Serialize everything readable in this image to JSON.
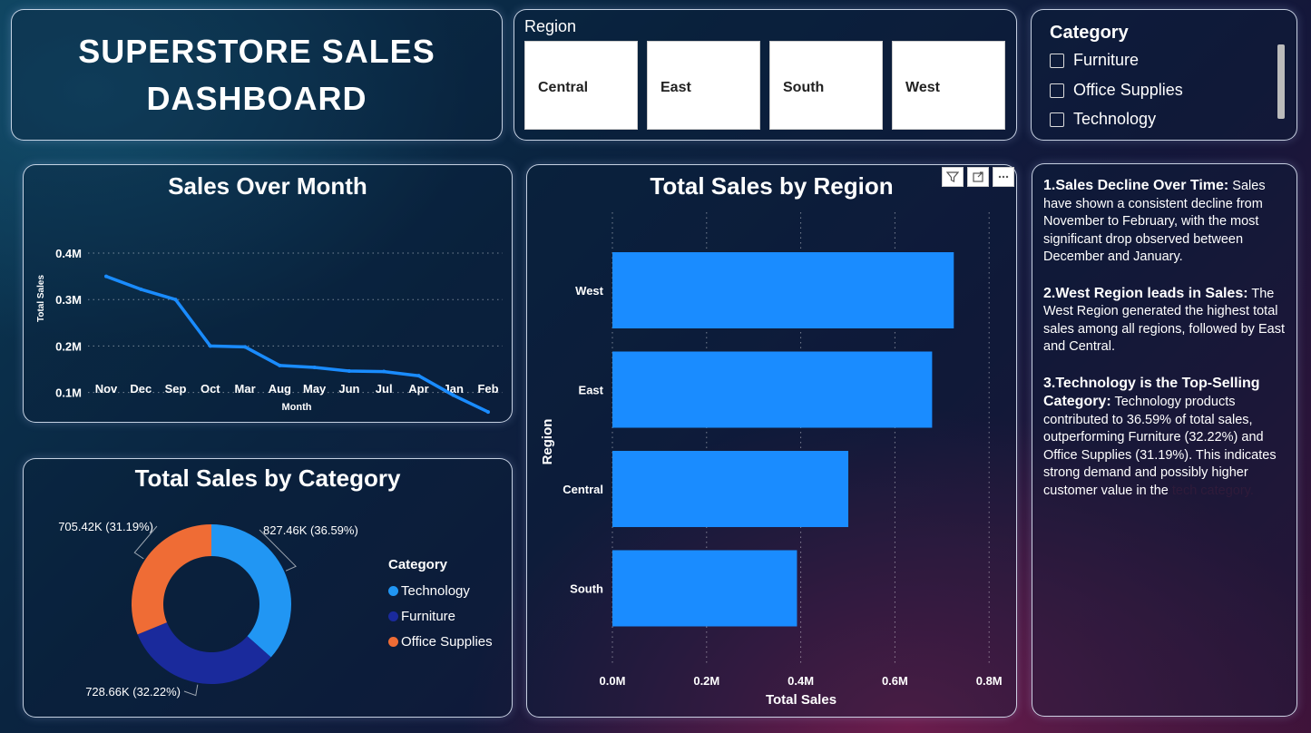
{
  "title": {
    "line1": "SUPERSTORE SALES",
    "line2": "DASHBOARD"
  },
  "region_slicer": {
    "label": "Region",
    "options": [
      "Central",
      "East",
      "South",
      "West"
    ]
  },
  "category_slicer": {
    "label": "Category",
    "options": [
      "Furniture",
      "Office Supplies",
      "Technology"
    ]
  },
  "insights": [
    {
      "heading": "1.Sales Decline Over Time:",
      "body": "Sales have shown a consistent decline from November to February, with the most significant drop observed between December and January."
    },
    {
      "heading": "2.West Region leads in Sales:",
      "body": "The West Region generated the highest total sales among all regions, followed by East and Central."
    },
    {
      "heading": "3.Technology is the Top-Selling Category:",
      "body": "Technology products contributed to 36.59% of total sales, outperforming Furniture (32.22%) and Office Supplies (31.19%). This indicates strong demand and possibly higher customer value in the",
      "faded": "tech category."
    }
  ],
  "visual_header_icons": [
    "filter-icon",
    "focus-mode-icon",
    "more-options-icon"
  ],
  "colors": {
    "bar": "#1a8cff",
    "line": "#1a8cff",
    "technology": "#2196f3",
    "furniture": "#1a2a9c",
    "office_supplies": "#ef6c35"
  },
  "chart_data": [
    {
      "type": "line",
      "title": "Sales Over Month",
      "xlabel": "Month",
      "ylabel": "Total Sales",
      "categories": [
        "Nov",
        "Dec",
        "Sep",
        "Oct",
        "Mar",
        "Aug",
        "May",
        "Jun",
        "Jul",
        "Apr",
        "Jan",
        "Feb"
      ],
      "values": [
        0.35,
        0.322,
        0.3,
        0.2,
        0.198,
        0.158,
        0.154,
        0.146,
        0.145,
        0.136,
        0.094,
        0.058
      ],
      "y_ticks": [
        "0.1M",
        "0.2M",
        "0.3M",
        "0.4M"
      ],
      "y_tick_values": [
        0.1,
        0.2,
        0.3,
        0.4
      ],
      "ylim": [
        0.05,
        0.4
      ],
      "grid": true
    },
    {
      "type": "bar",
      "orientation": "horizontal",
      "title": "Total Sales by Region",
      "xlabel": "Total Sales",
      "ylabel": "Region",
      "categories": [
        "West",
        "East",
        "Central",
        "South"
      ],
      "values": [
        0.725,
        0.679,
        0.501,
        0.392
      ],
      "x_ticks": [
        "0.0M",
        "0.2M",
        "0.4M",
        "0.6M",
        "0.8M"
      ],
      "x_tick_values": [
        0,
        0.2,
        0.4,
        0.6,
        0.8
      ],
      "xlim": [
        0,
        0.8
      ],
      "grid": true
    },
    {
      "type": "pie",
      "style": "donut",
      "title": "Total Sales by Category",
      "legend_title": "Category",
      "legend_placement": "right",
      "slices": [
        {
          "name": "Technology",
          "value": 827.46,
          "label": "827.46K (36.59%)"
        },
        {
          "name": "Furniture",
          "value": 728.66,
          "label": "728.66K (32.22%)"
        },
        {
          "name": "Office Supplies",
          "value": 705.42,
          "label": "705.42K (31.19%)"
        }
      ]
    }
  ]
}
